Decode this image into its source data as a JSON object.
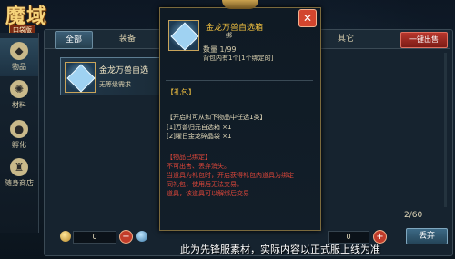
{
  "logo": {
    "title": "魔域",
    "subtitle": "口袋版"
  },
  "sidebar": {
    "items": [
      {
        "label": "物品",
        "icon": "bag-icon"
      },
      {
        "label": "材料",
        "icon": "material-icon"
      },
      {
        "label": "孵化",
        "icon": "egg-icon"
      },
      {
        "label": "随身商店",
        "icon": "shop-icon"
      }
    ]
  },
  "tabs": [
    {
      "label": "全部"
    },
    {
      "label": "装备"
    },
    {
      "label": "其它"
    }
  ],
  "sell_button": "一键出售",
  "list_item": {
    "name": "金龙万兽自选",
    "requirement": "无等级需求"
  },
  "currency": {
    "coin_value": "0",
    "diamond_value": "0"
  },
  "capacity": "2/60",
  "discard_button": "丢弃",
  "popup": {
    "name": "金龙万兽自选箱",
    "bind_tag": "绑",
    "quantity": "数量 1/99",
    "bag_info": "背包内有1个[1个绑定的]",
    "section_title": "【礼包】",
    "line1": "【开启时可从如下物品中任选1类】",
    "line2": "[1]万兽归元自选箱 ×1",
    "line3": "[2]曜日金龙碎晶袋 ×1",
    "warn1": "【物品已绑定】",
    "warn2": "不可出售、丢弃消失。",
    "warn3": "当道具为礼包时，开启获得礼包内道具为绑定",
    "warn4": "同礼包，使用后无法交易。",
    "warn5": "道具，该道具可以解绑后交易"
  },
  "watermark": "此为先锋服素材，实际内容以正式服上线为准",
  "colors": {
    "accent_gold": "#f0c040",
    "warning_red": "#e0473a",
    "sell_red": "#b8372d"
  }
}
